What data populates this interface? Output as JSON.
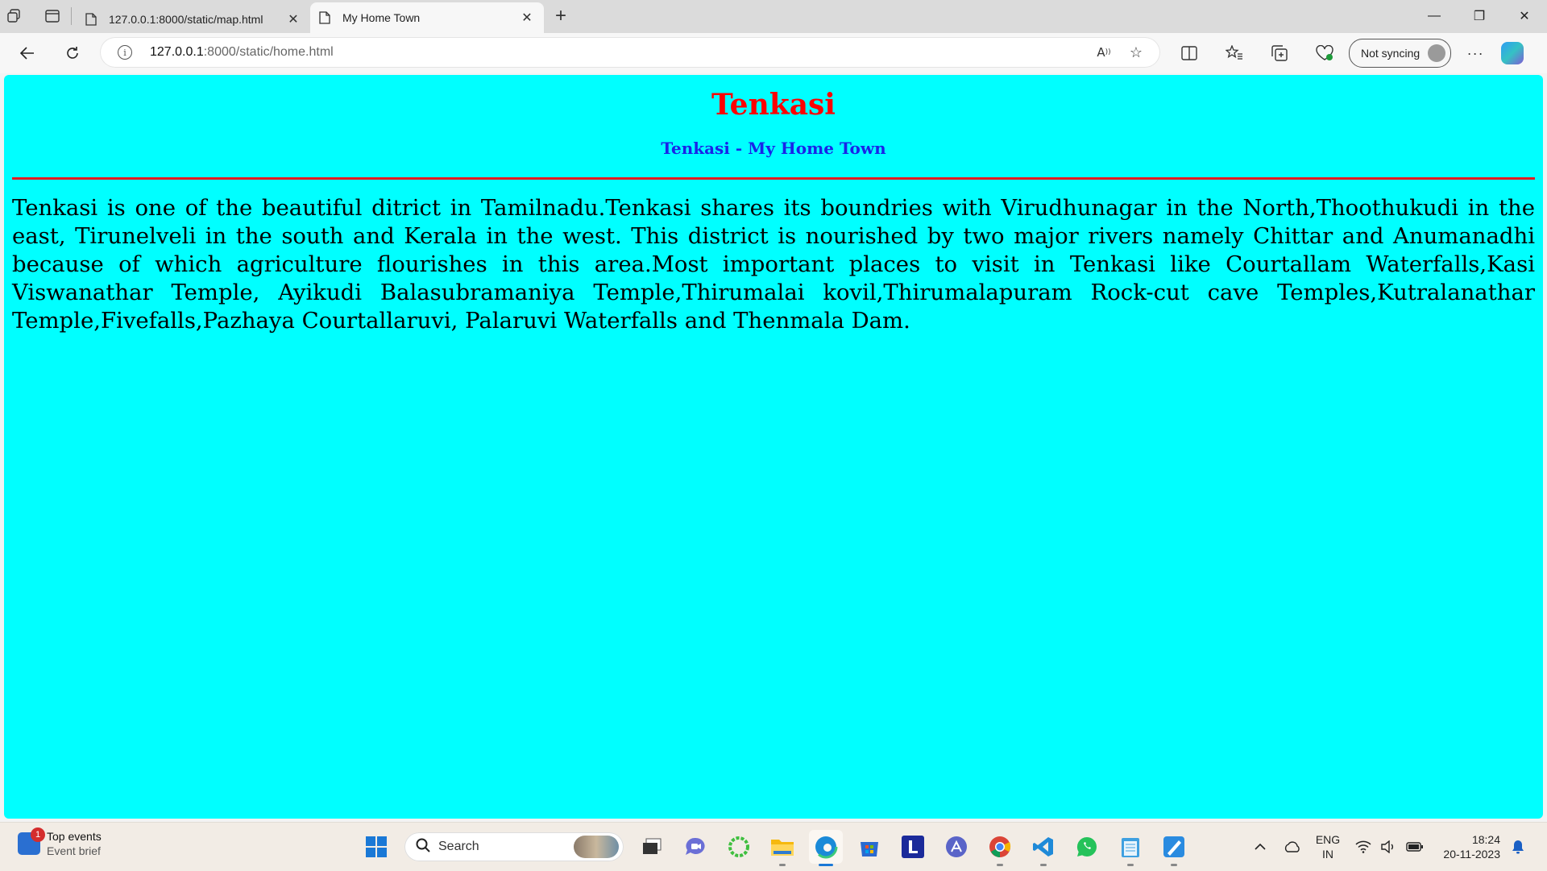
{
  "browser": {
    "tabs": [
      {
        "title": "127.0.0.1:8000/static/map.html",
        "active": false
      },
      {
        "title": "My Home Town",
        "active": true
      }
    ],
    "address": {
      "host": "127.0.0.1",
      "path": ":8000/static/home.html"
    },
    "sync_label": "Not syncing"
  },
  "page": {
    "heading": "Tenkasi",
    "subheading": "Tenkasi - My Home Town",
    "paragraph": "Tenkasi is one of the beautiful ditrict in Tamilnadu.Tenkasi shares its boundries with Virudhunagar in the North,Thoothukudi in the east, Tirunelveli in the south and Kerala in the west. This district is nourished by two major rivers namely Chittar and Anumanadhi because of which agriculture flourishes in this area.Most important places to visit in Tenkasi like Courtallam Waterfalls,Kasi Viswanathar Temple, Ayikudi Balasubramaniya Temple,Thirumalai kovil,Thirumalapuram Rock-cut cave Temples,Kutralanathar Temple,Fivefalls,Pazhaya Courtallaruvi, Palaruvi Waterfalls and Thenmala Dam.",
    "colors": {
      "background": "#00ffff",
      "heading": "#ff0000",
      "subheading": "#1a24e8",
      "rule": "#e31b22"
    }
  },
  "taskbar": {
    "widget": {
      "badge": "1",
      "title": "Top events",
      "subtitle": "Event brief"
    },
    "search_label": "Search",
    "language": {
      "line1": "ENG",
      "line2": "IN"
    },
    "time": "18:24",
    "date": "20-11-2023"
  }
}
